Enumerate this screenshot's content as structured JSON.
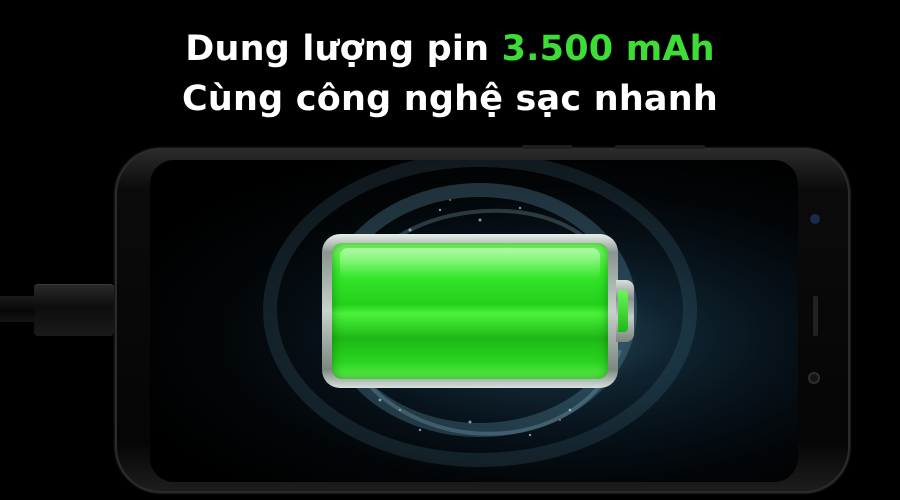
{
  "headline": {
    "line1_prefix": "Dung lượng pin ",
    "line1_highlight": "3.500 mAh",
    "line2": "Cùng công nghệ sạc nhanh"
  },
  "colors": {
    "background": "#000000",
    "text": "#ffffff",
    "accent": "#3ddc36",
    "battery_fill": "#2fd626"
  },
  "battery": {
    "charge_level": 1.0,
    "icon": "charging-battery-icon"
  },
  "phone": {
    "orientation": "landscape",
    "icon": "smartphone-icon"
  },
  "cable": {
    "icon": "usb-cable-icon"
  }
}
